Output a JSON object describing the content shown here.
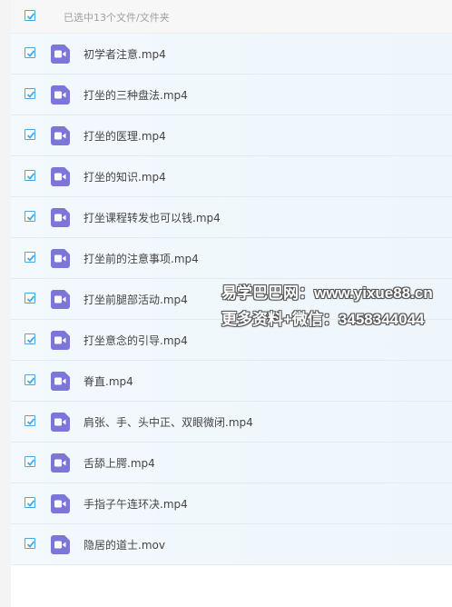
{
  "colors": {
    "accent": "#49a8e3",
    "file_icon": "#7b76d8",
    "row_background": "#f0f7fd"
  },
  "header": {
    "select_all_checked": true,
    "summary": "已选中13个文件/文件夹"
  },
  "files": [
    {
      "name": "初学者注意.mp4",
      "checked": true,
      "icon": "video-file-icon"
    },
    {
      "name": "打坐的三种盘法.mp4",
      "checked": true,
      "icon": "video-file-icon"
    },
    {
      "name": "打坐的医理.mp4",
      "checked": true,
      "icon": "video-file-icon"
    },
    {
      "name": "打坐的知识.mp4",
      "checked": true,
      "icon": "video-file-icon"
    },
    {
      "name": "打坐课程转发也可以钱.mp4",
      "checked": true,
      "icon": "video-file-icon"
    },
    {
      "name": "打坐前的注意事项.mp4",
      "checked": true,
      "icon": "video-file-icon"
    },
    {
      "name": "打坐前腿部活动.mp4",
      "checked": true,
      "icon": "video-file-icon"
    },
    {
      "name": "打坐意念的引导.mp4",
      "checked": true,
      "icon": "video-file-icon"
    },
    {
      "name": "脊直.mp4",
      "checked": true,
      "icon": "video-file-icon"
    },
    {
      "name": "肩张、手、头中正、双眼微闭.mp4",
      "checked": true,
      "icon": "video-file-icon"
    },
    {
      "name": "舌舔上腭.mp4",
      "checked": true,
      "icon": "video-file-icon"
    },
    {
      "name": "手指子午连环决.mp4",
      "checked": true,
      "icon": "video-file-icon"
    },
    {
      "name": "隐居的道士.mov",
      "checked": true,
      "icon": "video-file-icon"
    }
  ],
  "watermark": {
    "line1": "易学巴巴网：www.yixue88.cn",
    "line2": "更多资料+微信：3458344044"
  }
}
